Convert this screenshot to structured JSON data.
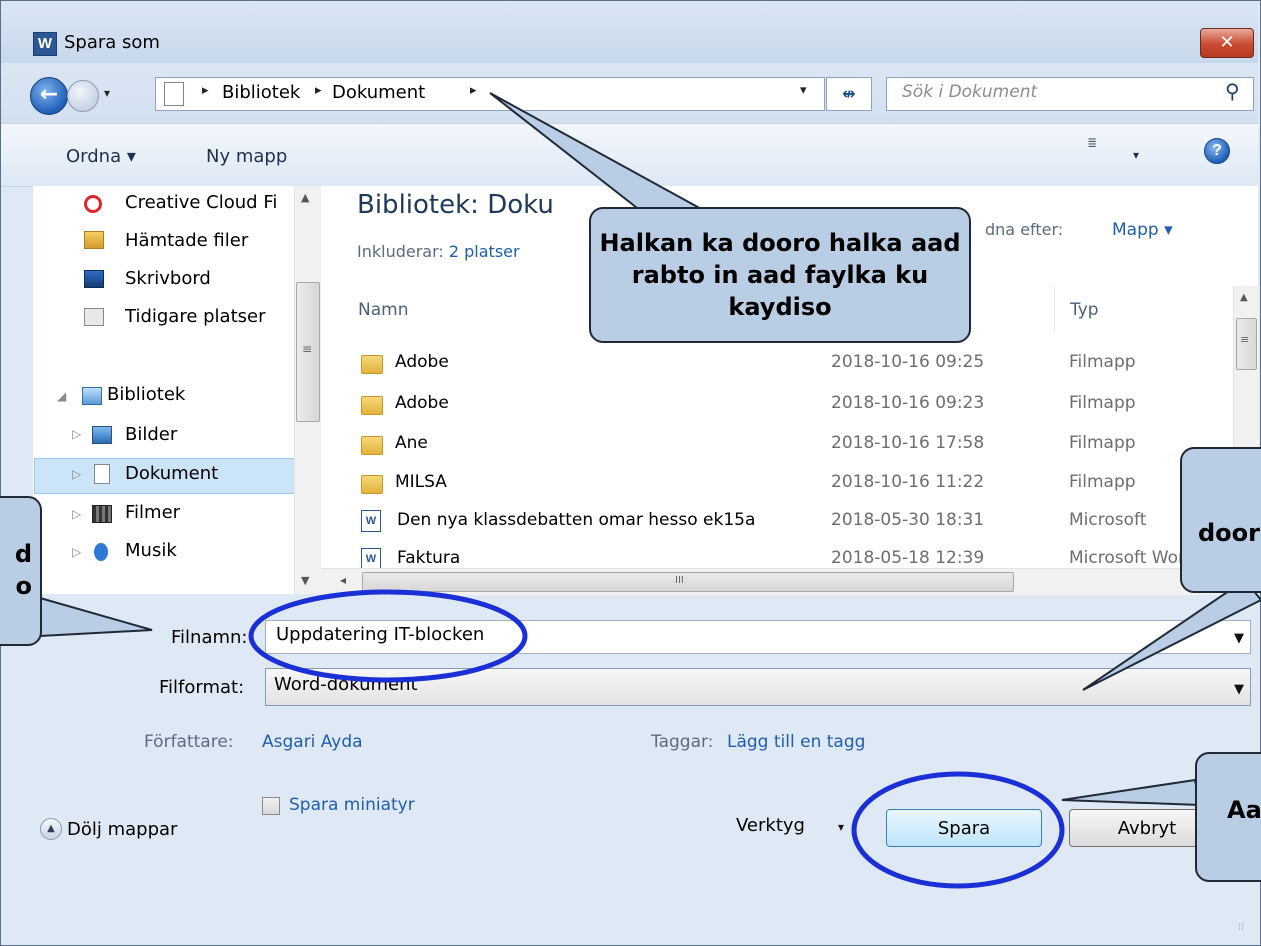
{
  "window": {
    "title": "Spara som",
    "app_icon_letter": "W",
    "close_label": "✕"
  },
  "nav": {
    "back_arrow": "←",
    "history_arrow": "▾",
    "breadcrumb": [
      "Bibliotek",
      "Dokument"
    ],
    "breadcrumb_separator": "▸",
    "dropdown_arrow": "▾",
    "refresh_label": "↮",
    "search_placeholder": "Sök i Dokument",
    "search_glyph": "⚲"
  },
  "toolbar": {
    "organize": "Ordna ▾",
    "new_folder": "Ny mapp",
    "view_glyph": "≣",
    "view_dropdown": "▾",
    "help_glyph": "?"
  },
  "sidebar": {
    "items": [
      {
        "label": "Creative Cloud Fi",
        "icon": "creative-cloud-icon"
      },
      {
        "label": "Hämtade filer",
        "icon": "downloads-icon"
      },
      {
        "label": "Skrivbord",
        "icon": "desktop-icon"
      },
      {
        "label": "Tidigare platser",
        "icon": "recent-places-icon"
      },
      {
        "label": "Bibliotek",
        "icon": "library-icon"
      },
      {
        "label": "Bilder",
        "icon": "pictures-icon"
      },
      {
        "label": "Dokument",
        "icon": "documents-icon"
      },
      {
        "label": "Filmer",
        "icon": "videos-icon"
      },
      {
        "label": "Musik",
        "icon": "music-icon"
      }
    ],
    "expand_open": "◢",
    "expand_closed": "▷",
    "scroll_up": "▲",
    "scroll_down": "▼",
    "scroll_grip": "≡"
  },
  "library": {
    "title": "Bibliotek: Doku",
    "includes_label": "Inkluderar:",
    "includes_link": "2 platser",
    "sort_label": "dna efter:",
    "sort_value": "Mapp ▾"
  },
  "files": {
    "columns": {
      "name": "Namn",
      "type": "Typ"
    },
    "rows": [
      {
        "name": "Adobe",
        "date": "2018-10-16 09:25",
        "type": "Filmapp",
        "icon": "folder-icon"
      },
      {
        "name": "Adobe",
        "date": "2018-10-16 09:23",
        "type": "Filmapp",
        "icon": "folder-icon"
      },
      {
        "name": "Ane",
        "date": "2018-10-16 17:58",
        "type": "Filmapp",
        "icon": "folder-icon"
      },
      {
        "name": "MILSA",
        "date": "2018-10-16 11:22",
        "type": "Filmapp",
        "icon": "folder-icon"
      },
      {
        "name": "Den nya klassdebatten omar hesso ek15a",
        "date": "2018-05-30 18:31",
        "type": "Microsoft",
        "icon": "word-document-icon"
      },
      {
        "name": "Faktura",
        "date": "2018-05-18 12:39",
        "type": "Microsoft Word",
        "icon": "word-document-icon"
      }
    ],
    "hscroll_left": "◂",
    "hscroll_grip": "III",
    "vscroll_up": "▲",
    "vscroll_grip": "≡"
  },
  "form": {
    "filename_label": "Filnamn:",
    "filename_value": "Uppdatering IT-blocken",
    "format_label": "Filformat:",
    "format_value": "Word-dokument",
    "author_label": "Författare:",
    "author_value": "Asgari Ayda",
    "tags_label": "Taggar:",
    "tags_value": "Lägg till en tagg",
    "thumbnail_label": "Spara miniatyr",
    "dropdown_arrow": "▼"
  },
  "footer": {
    "hide_folders": "Dölj mappar",
    "hide_glyph": "▲",
    "tools": "Verktyg",
    "tools_arrow": "▾",
    "save": "Spara",
    "cancel": "Avbryt",
    "grip": "⁝⁝"
  },
  "annotations": {
    "path_callout": "Halkan ka dooro halka aad rabto in aad faylka ku kaydiso",
    "left_callout": "d\no",
    "format_callout": "door",
    "save_callout": "Aa"
  },
  "colors": {
    "accent": "#1f5fb0",
    "callout_fill": "#b9cde5",
    "highlight_ellipse": "#1a2fd6",
    "selection": "#cce4f7"
  }
}
